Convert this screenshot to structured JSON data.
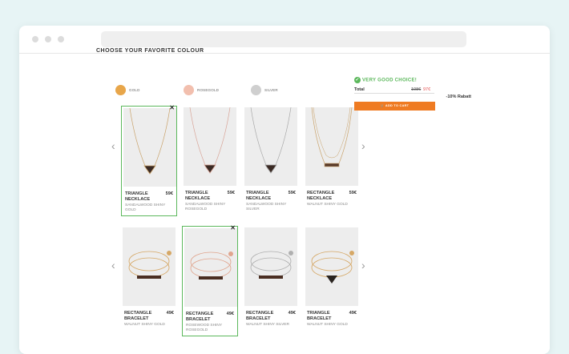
{
  "heading": "CHOOSE YOUR FAVORITE COLOUR",
  "colours": [
    {
      "label": "GOLD",
      "color": "#e8a64a"
    },
    {
      "label": "ROSEGOLD",
      "color": "#f2bfae"
    },
    {
      "label": "SILVER",
      "color": "#cfcfcf"
    }
  ],
  "necklaces": [
    {
      "name": "TRIANGLE NECKLACE",
      "price": "59€",
      "desc": "SANDALWOOD SHINY GOLD",
      "selected": true,
      "metal": "#c9a26a",
      "pendant": "triangle"
    },
    {
      "name": "TRIANGLE NECKLACE",
      "price": "59€",
      "desc": "SANDALWOOD SHINY ROSEGOLD",
      "selected": false,
      "metal": "#d8a497",
      "pendant": "triangle"
    },
    {
      "name": "TRIANGLE NECKLACE",
      "price": "59€",
      "desc": "SANDALWOOD SHINY SILVER",
      "selected": false,
      "metal": "#a9a9a9",
      "pendant": "triangle"
    },
    {
      "name": "RECTANGLE NECKLACE",
      "price": "59€",
      "desc": "WALNUT SHINY GOLD",
      "selected": false,
      "metal": "#c9a26a",
      "pendant": "rectangle"
    }
  ],
  "bracelets": [
    {
      "name": "RECTANGLE BRACELET",
      "price": "49€",
      "desc": "WALNUT SHINY GOLD",
      "selected": false,
      "metal": "#d6a866",
      "pendant": "rectangle"
    },
    {
      "name": "RECTANGLE BRACELET",
      "price": "49€",
      "desc": "ROSEWOOD SHINY ROSEGOLD",
      "selected": true,
      "metal": "#e0a58e",
      "pendant": "rectangle"
    },
    {
      "name": "RECTANGLE BRACELET",
      "price": "49€",
      "desc": "WALNUT SHINY SILVER",
      "selected": false,
      "metal": "#b0b0b0",
      "pendant": "rectangle"
    },
    {
      "name": "TRIANGLE BRACELET",
      "price": "49€",
      "desc": "WALNUT SHINY GOLD",
      "selected": false,
      "metal": "#d6a866",
      "pendant": "triangle"
    }
  ],
  "summary": {
    "choice": "VERY GOOD CHOICE!",
    "total_label": "Total",
    "old_price": "108€",
    "new_price": "97€",
    "discount": "-10% Rabatt",
    "cart_label": "ADD TO CART"
  }
}
